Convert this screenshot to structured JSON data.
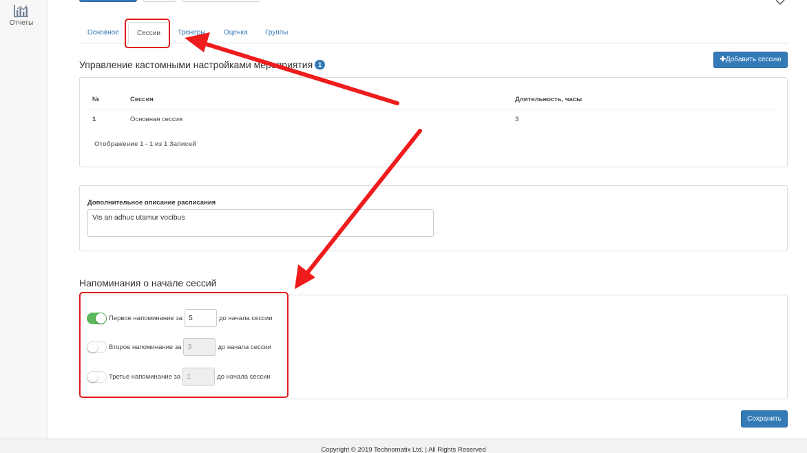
{
  "nav": {
    "reports_label": "Отчеты",
    "reports_icon": "chart-icon"
  },
  "tabs": [
    {
      "label": "Основное"
    },
    {
      "label": "Сессии"
    },
    {
      "label": "Тренеры"
    },
    {
      "label": "Оценка"
    },
    {
      "label": "Группы"
    }
  ],
  "sessions": {
    "title": "Управление кастомными настройками мероприятия",
    "badge": "1",
    "add_button": "Добавить сессию",
    "columns": [
      "№",
      "Сессия",
      "Длительность, часы"
    ],
    "rows": [
      {
        "num": "1",
        "name": "Основная сессия",
        "duration": "3"
      }
    ],
    "info": "Отображение 1 - 1 из 1 Записей"
  },
  "schedule": {
    "label": "Дополнительное описание расписания",
    "value": "Vis an adhuc utamur vocibus"
  },
  "reminders": {
    "title": "Напоминания о начале сессий",
    "items": [
      {
        "label": "Первое напоминание за",
        "value": "5",
        "suffix": "до начала сессии",
        "enabled": true
      },
      {
        "label": "Второе напоминание за",
        "value": "3",
        "suffix": "до начала сессии",
        "enabled": false
      },
      {
        "label": "Третье напоминание за",
        "value": "1",
        "suffix": "до начала сессии",
        "enabled": false
      }
    ]
  },
  "save_button": "Сохранить",
  "footer": "Copyright © 2019 Technomatix Ltd. | All Rights Reserved",
  "colors": {
    "primary": "#337ab7",
    "toggle_on": "#5cb85c",
    "annotation": "#e3191d"
  }
}
